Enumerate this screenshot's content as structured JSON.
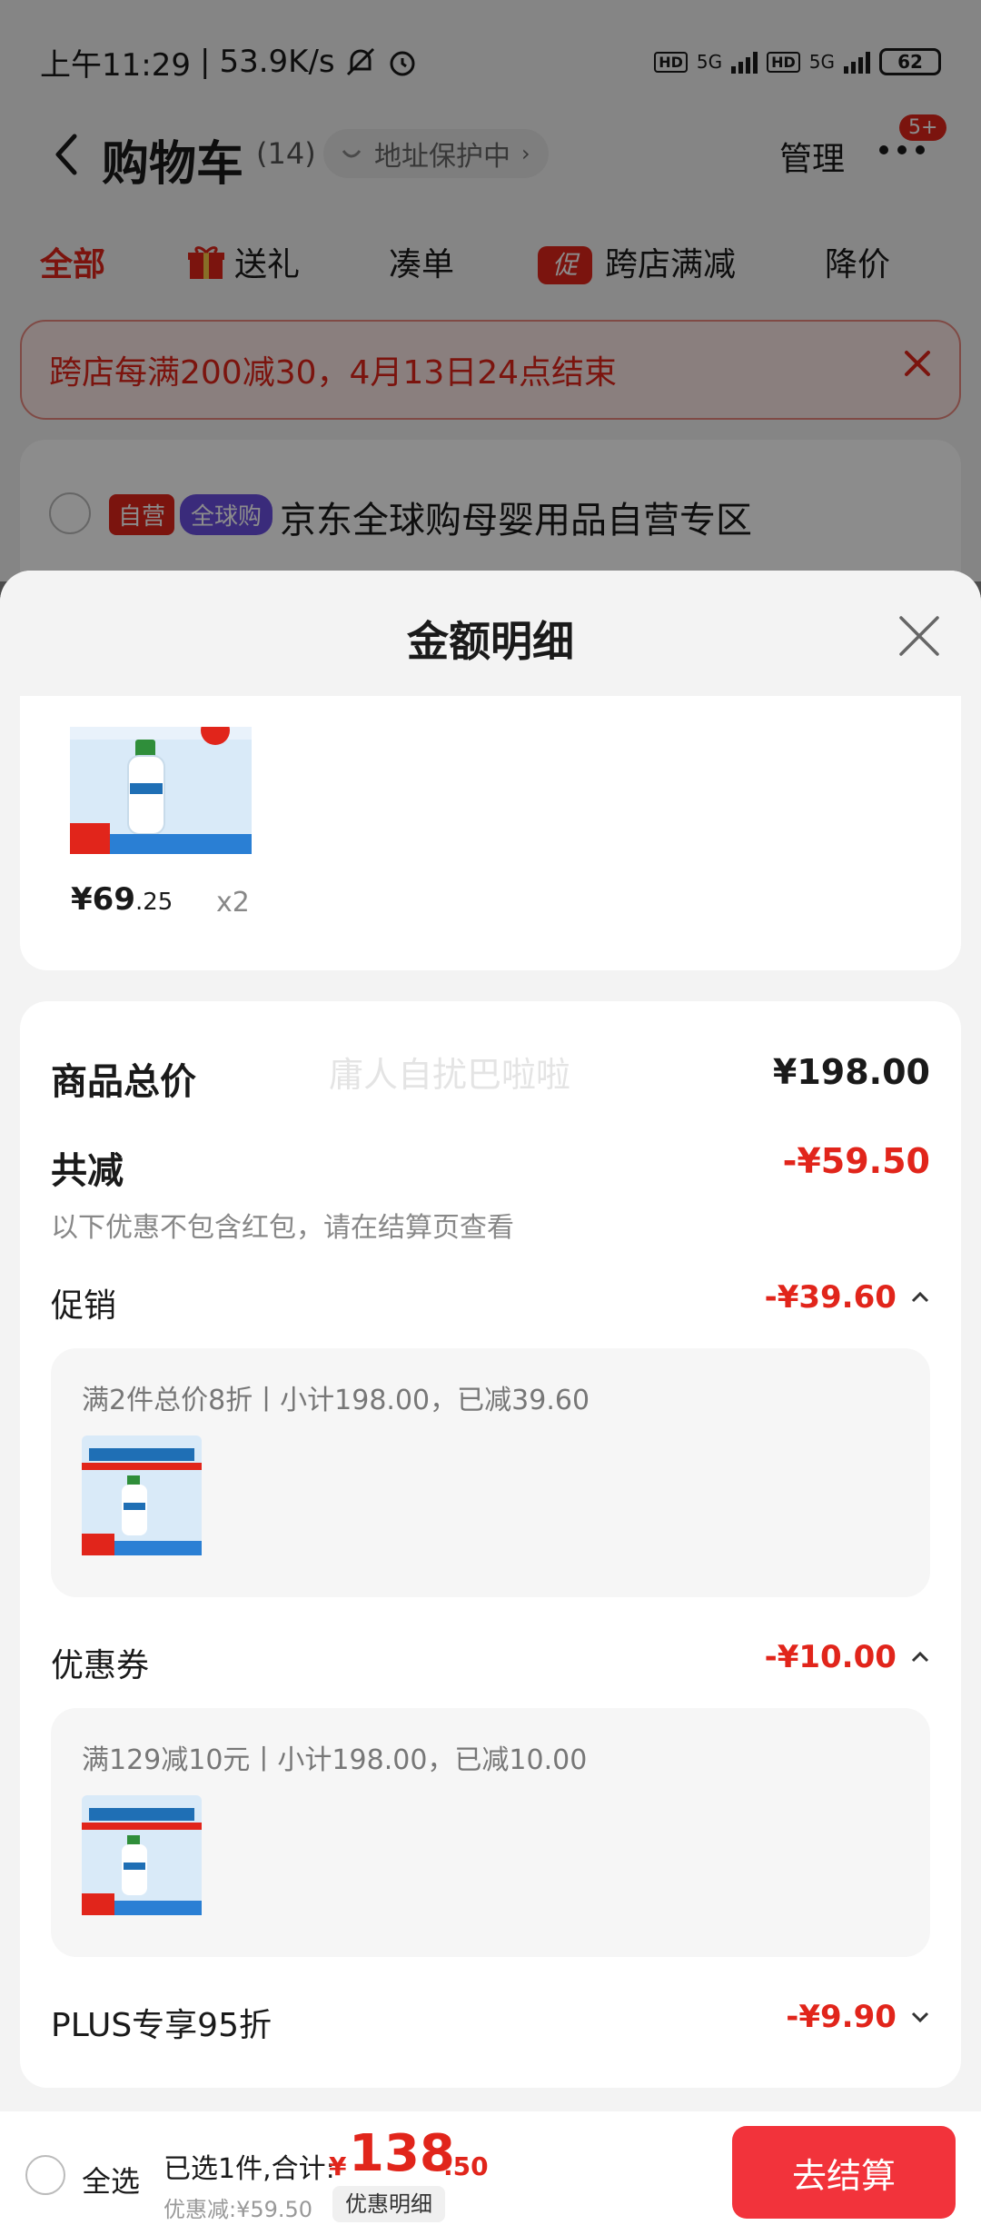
{
  "status_bar": {
    "time": "上午11:29",
    "separator": "|",
    "net_speed": "53.9K/s",
    "hd": "HD",
    "net_type": "5G",
    "battery": "62"
  },
  "nav": {
    "title": "购物车",
    "count": "(14)",
    "address_protect": "地址保护中",
    "manage": "管理",
    "msg_badge": "5+"
  },
  "tabs": [
    "全部",
    "送礼",
    "凑单",
    "跨店满减",
    "降价"
  ],
  "tab_promo_glyph": "促",
  "banner": {
    "text": "跨店每满200减30，4月13日24点结束"
  },
  "store": {
    "tag_self": "自营",
    "tag_global": "全球购",
    "name": "京东全球购母婴用品自营专区"
  },
  "sheet": {
    "title": "金额明细",
    "product": {
      "price_int": "¥69",
      "price_dec": ".25",
      "qty": "x2"
    },
    "watermark": "庸人自扰巴啦啦",
    "total_label": "商品总价",
    "total_amount": "¥198.00",
    "discount_label": "共减",
    "discount_amount": "-¥59.50",
    "discount_note": "以下优惠不包含红包，请在结算页查看",
    "promo": {
      "label": "促销",
      "amount": "-¥39.60",
      "rule": "满2件总价8折丨小计198.00，已减39.60"
    },
    "coupon": {
      "label": "优惠券",
      "amount": "-¥10.00",
      "rule": "满129减10元丨小计198.00，已减10.00"
    },
    "plus": {
      "label": "PLUS专享95折",
      "amount": "-¥9.90"
    }
  },
  "bottom": {
    "select_all": "全选",
    "selected_label": "已选1件,合计:",
    "currency": "¥",
    "total_int": "138",
    "total_dec": ".50",
    "discount_note": "优惠减:¥59.50",
    "detail_button": "优惠明细",
    "checkout": "去结算"
  },
  "colors": {
    "accent_red": "#e1251b",
    "checkout_red": "#f2333b",
    "global_purple": "#6a4fe0"
  },
  "icons": [
    "back-icon",
    "bell-off-icon",
    "alarm-icon",
    "signal-icon",
    "battery-icon",
    "gift-icon",
    "close-icon",
    "chevron-up-icon",
    "chevron-down-icon",
    "more-icon"
  ]
}
